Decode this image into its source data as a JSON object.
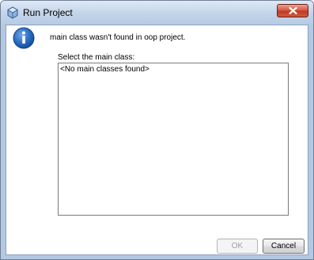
{
  "window": {
    "title": "Run Project",
    "title_icon": "netbeans-cube-icon",
    "close_icon": "close-icon"
  },
  "dialog": {
    "icon": "info-icon",
    "message": "main class wasn't found in oop project.",
    "select_label": "Select the main class:",
    "list_items": [
      "<No main classes found>"
    ]
  },
  "buttons": {
    "ok_label": "OK",
    "ok_enabled": false,
    "cancel_label": "Cancel"
  },
  "colors": {
    "titlebar": "#c4d5ea",
    "close_button": "#c13a22",
    "info_icon": "#1e63b8"
  }
}
